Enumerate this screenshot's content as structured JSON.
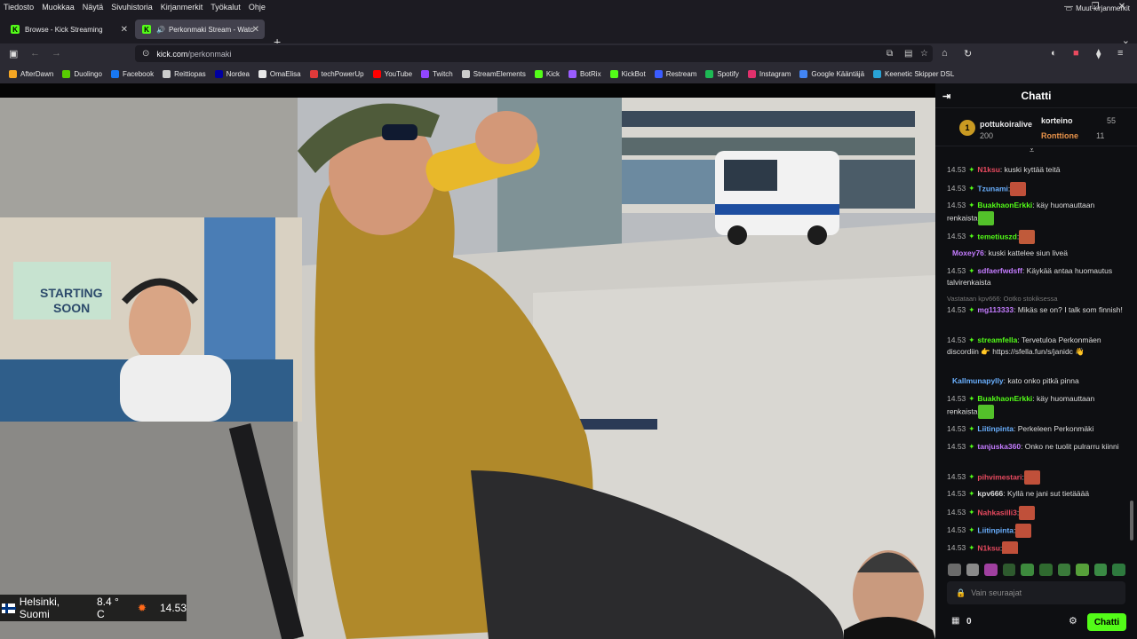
{
  "menu": [
    "Tiedosto",
    "Muokkaa",
    "Näytä",
    "Sivuhistoria",
    "Kirjanmerkit",
    "Työkalut",
    "Ohje"
  ],
  "tabs": [
    {
      "title": "Browse - Kick Streaming",
      "active": false
    },
    {
      "title": "Perkonmaki Stream - Watch",
      "active": true
    }
  ],
  "url": {
    "domain": "kick.com",
    "path": "/perkonmaki"
  },
  "bookmarks": [
    {
      "label": "AfterDawn",
      "color": "#f5a623"
    },
    {
      "label": "Duolingo",
      "color": "#58cc02"
    },
    {
      "label": "Facebook",
      "color": "#1877f2"
    },
    {
      "label": "Reittiopas",
      "color": "#cccccc"
    },
    {
      "label": "Nordea",
      "color": "#0000a0"
    },
    {
      "label": "OmaElisa",
      "color": "#e8e8e8"
    },
    {
      "label": "techPowerUp",
      "color": "#e03a3a"
    },
    {
      "label": "YouTube",
      "color": "#ff0000"
    },
    {
      "label": "Twitch",
      "color": "#9146ff"
    },
    {
      "label": "StreamElements",
      "color": "#cccccc"
    },
    {
      "label": "Kick",
      "color": "#53fc18"
    },
    {
      "label": "BotRix",
      "color": "#9a5cff"
    },
    {
      "label": "KickBot",
      "color": "#53fc18"
    },
    {
      "label": "Restream",
      "color": "#3b5cff"
    },
    {
      "label": "Spotify",
      "color": "#1db954"
    },
    {
      "label": "Instagram",
      "color": "#e1306c"
    },
    {
      "label": "Google Kääntäjä",
      "color": "#4285f4"
    },
    {
      "label": "Keenetic Skipper DSL",
      "color": "#29a3d6"
    }
  ],
  "other_bookmarks": "Muut kirjanmerkit",
  "chat": {
    "title": "Chatti",
    "leaderboard": [
      {
        "name": "pottukoiralive",
        "value": "200",
        "color": "#e8b23a"
      },
      {
        "name": "korteino",
        "value": "55",
        "color": "#ffffff"
      },
      {
        "name": "Ronttione",
        "value": "11",
        "color": "#e8934a"
      }
    ],
    "leader_rank": "1",
    "messages": [
      {
        "time": "14.53",
        "user": "N1ksu",
        "color": "#e84a5f",
        "text": ": kuski kyttää teitä",
        "emote": null
      },
      {
        "time": "14.53",
        "user": "Tzunami",
        "color": "#6ab0ff",
        "text": ":",
        "emote": "#c0503a"
      },
      {
        "time": "14.53",
        "user": "BuakhaonErkki",
        "color": "#53fc18",
        "text": ": käy huomauttaan renkaista",
        "emote": "#53c12a"
      },
      {
        "time": "14.53",
        "user": "temetiuszd",
        "color": "#53fc18",
        "text": ":",
        "emote": "#c05a3a"
      },
      {
        "time": "",
        "user": "Moxey76",
        "color": "#c47cff",
        "text": ": kuski kattelee siun liveä",
        "emote": null
      },
      {
        "time": "14.53",
        "user": "sdfaerfwdsff",
        "color": "#c47cff",
        "text": ": Käykää antaa huomautus talvirenkaista",
        "emote": null
      },
      {
        "time": "14.53",
        "user": "mg113333",
        "color": "#c47cff",
        "text": ": Mikäs se on? I talk som finnish!",
        "emote": null
      },
      {
        "time": "14.53",
        "user": "streamfella",
        "color": "#53fc18",
        "text": ": Tervetuloa Perkonmäen discordiin 👉 https://sfella.fun/s/janidc 👋",
        "emote": null
      },
      {
        "time": "",
        "user": "Kallmunapylly",
        "color": "#6ab0ff",
        "text": ": kato onko pitkä pinna",
        "emote": null
      },
      {
        "time": "14.53",
        "user": "BuakhaonErkki",
        "color": "#53fc18",
        "text": ": käy huomauttaan renkaista",
        "emote": "#53c12a"
      },
      {
        "time": "14.53",
        "user": "Liitinpinta",
        "color": "#6ab0ff",
        "text": ": Perkeleen Perkonmäki",
        "emote": null
      },
      {
        "time": "14.53",
        "user": "tanjuska360",
        "color": "#c47cff",
        "text": ": Onko ne tuolit pulrarru kiinni",
        "emote": null
      },
      {
        "time": "14.53",
        "user": "pihvimestari",
        "color": "#e84a5f",
        "text": ":",
        "emote": "#c0503a"
      },
      {
        "time": "14.53",
        "user": "kpv666",
        "color": "#dddddd",
        "text": ": Kyllä ne jani sut tietääää",
        "emote": null
      },
      {
        "time": "14.53",
        "user": "Nahkasilli3",
        "color": "#e84a5f",
        "text": ":",
        "emote": "#c0503a"
      },
      {
        "time": "14.53",
        "user": "Liitinpinta",
        "color": "#6ab0ff",
        "text": ":",
        "emote": "#c0503a"
      },
      {
        "time": "14.53",
        "user": "N1ksu",
        "color": "#e84a5f",
        "text": ":",
        "emote": "#c0503a"
      }
    ],
    "reply_text": "Vastataan kpv666: Ootko stokiksessa",
    "input_placeholder": "Vain seuraajat",
    "viewers": "0",
    "send_label": "Chatti"
  },
  "overlay": {
    "location": "Helsinki, Suomi",
    "temp": "8.4 ° C",
    "time": "14.53"
  }
}
